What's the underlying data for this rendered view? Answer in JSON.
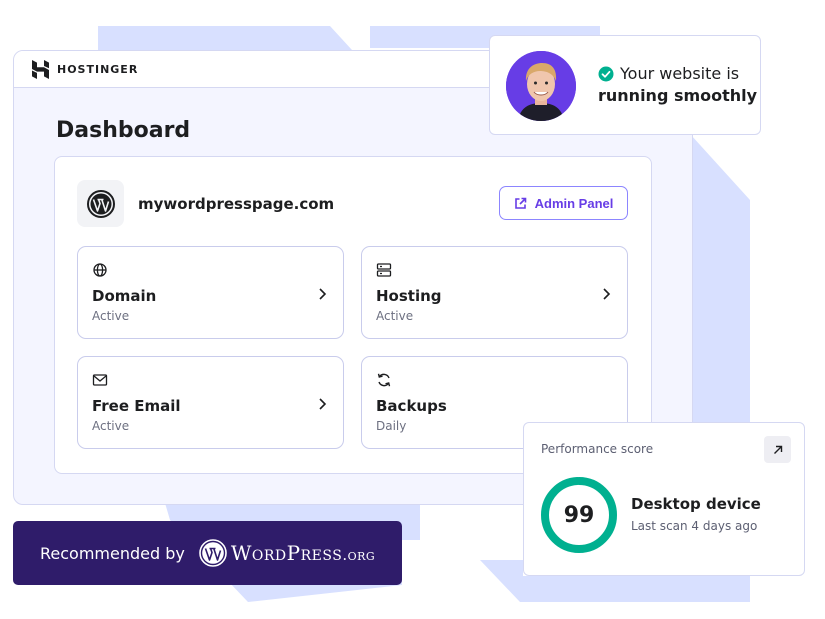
{
  "brand": {
    "name": "HOSTINGER"
  },
  "dashboard": {
    "title": "Dashboard",
    "site_name": "mywordpresspage.com",
    "admin_button_label": "Admin Panel",
    "tiles": [
      {
        "label": "Domain",
        "status": "Active",
        "icon": "globe-icon"
      },
      {
        "label": "Hosting",
        "status": "Active",
        "icon": "server-icon"
      },
      {
        "label": "Free Email",
        "status": "Active",
        "icon": "mail-icon"
      },
      {
        "label": "Backups",
        "status": "Daily",
        "icon": "refresh-icon"
      }
    ]
  },
  "status": {
    "line1": "Your website is",
    "line2": "running smoothly",
    "icon": "check-circle-icon"
  },
  "performance": {
    "label": "Performance score",
    "score": "99",
    "score_fraction": 0.99,
    "device": "Desktop device",
    "last_scan": "Last scan 4 days ago"
  },
  "recommend": {
    "text": "Recommended by",
    "brand_word": "WordPress",
    "brand_suffix": ".org"
  },
  "colors": {
    "accent": "#673de6",
    "gauge": "#00b090",
    "banner": "#2f1c6a",
    "background_shape": "#d8e0ff"
  }
}
